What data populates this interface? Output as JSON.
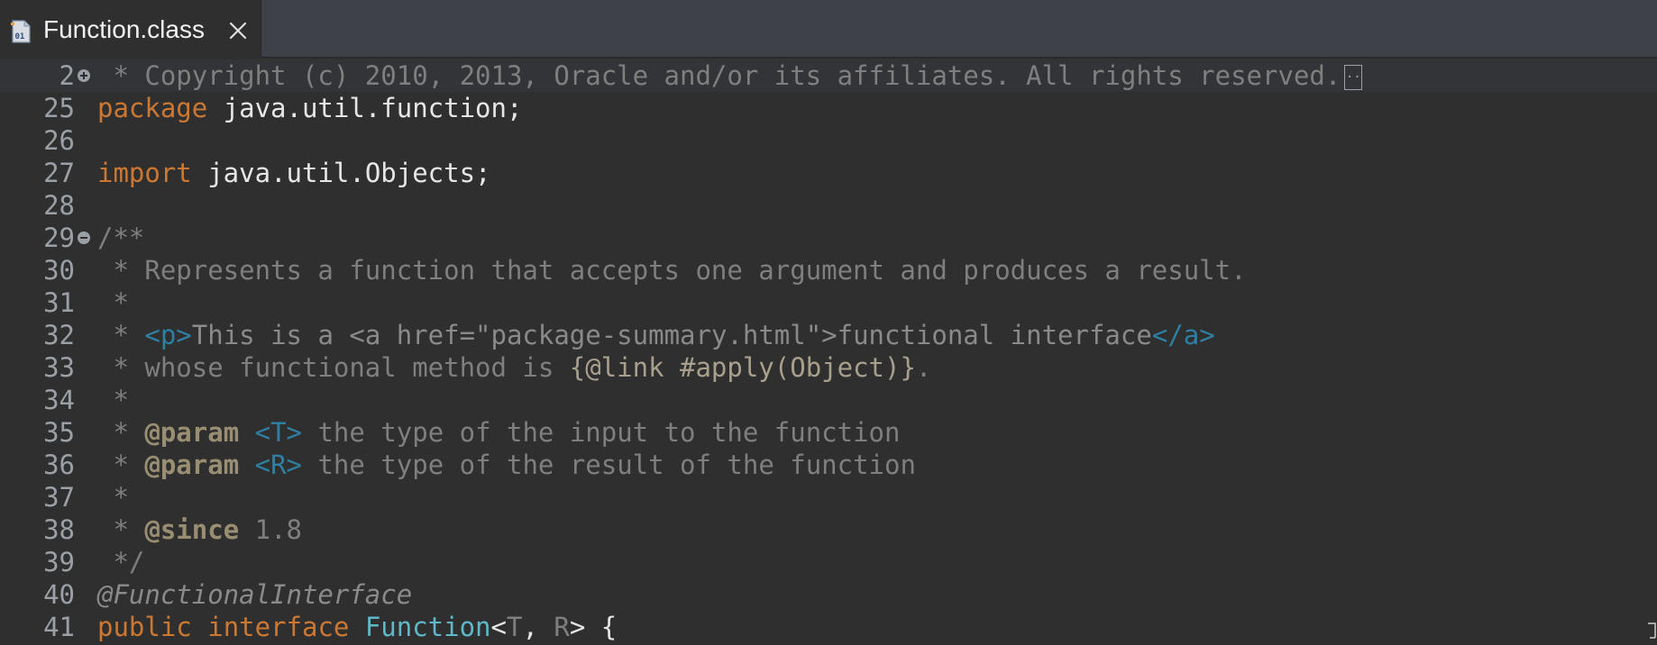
{
  "tab": {
    "title": "Function.class",
    "icon": "class-file-icon",
    "close_icon": "close-icon"
  },
  "editor": {
    "lines": [
      {
        "num": "2",
        "fold": "expand",
        "current": true,
        "parts": [
          {
            "cls": "cm",
            "text": " * Copyright (c) 2010, 2013, Oracle and/or its affiliates. All rights reserved."
          }
        ],
        "folded_marker": ".."
      },
      {
        "num": "25",
        "parts": [
          {
            "cls": "kw",
            "text": "package"
          },
          {
            "cls": "txt",
            "text": " java.util.function;"
          }
        ]
      },
      {
        "num": "26",
        "parts": []
      },
      {
        "num": "27",
        "parts": [
          {
            "cls": "kw",
            "text": "import"
          },
          {
            "cls": "txt",
            "text": " java.util.Objects;"
          }
        ]
      },
      {
        "num": "28",
        "parts": []
      },
      {
        "num": "29",
        "fold": "collapse",
        "parts": [
          {
            "cls": "cm",
            "text": "/**"
          }
        ]
      },
      {
        "num": "30",
        "parts": [
          {
            "cls": "cm",
            "text": " * Represents a function that accepts one argument and produces a result."
          }
        ]
      },
      {
        "num": "31",
        "parts": [
          {
            "cls": "cm",
            "text": " *"
          }
        ]
      },
      {
        "num": "32",
        "parts": [
          {
            "cls": "cm",
            "text": " * "
          },
          {
            "cls": "tag",
            "text": "<p>"
          },
          {
            "cls": "tagtxt",
            "text": "This is a <a href=\"package-summary.html\">functional interface"
          },
          {
            "cls": "tag",
            "text": "</a>"
          }
        ]
      },
      {
        "num": "33",
        "parts": [
          {
            "cls": "cm",
            "text": " * whose functional method is "
          },
          {
            "cls": "lnk",
            "text": "{@link #apply(Object)}"
          },
          {
            "cls": "cm",
            "text": "."
          }
        ]
      },
      {
        "num": "34",
        "parts": [
          {
            "cls": "cm",
            "text": " *"
          }
        ]
      },
      {
        "num": "35",
        "parts": [
          {
            "cls": "cm",
            "text": " * "
          },
          {
            "cls": "doctag",
            "text": "@param"
          },
          {
            "cls": "cm",
            "text": " "
          },
          {
            "cls": "tparam",
            "text": "<T>"
          },
          {
            "cls": "cm",
            "text": " the type of the input to the function"
          }
        ]
      },
      {
        "num": "36",
        "parts": [
          {
            "cls": "cm",
            "text": " * "
          },
          {
            "cls": "doctag",
            "text": "@param"
          },
          {
            "cls": "cm",
            "text": " "
          },
          {
            "cls": "tparam",
            "text": "<R>"
          },
          {
            "cls": "cm",
            "text": " the type of the result of the function"
          }
        ]
      },
      {
        "num": "37",
        "parts": [
          {
            "cls": "cm",
            "text": " *"
          }
        ]
      },
      {
        "num": "38",
        "parts": [
          {
            "cls": "cm",
            "text": " * "
          },
          {
            "cls": "doctag",
            "text": "@since"
          },
          {
            "cls": "cm",
            "text": " 1.8"
          }
        ]
      },
      {
        "num": "39",
        "parts": [
          {
            "cls": "cm",
            "text": " */"
          }
        ]
      },
      {
        "num": "40",
        "parts": [
          {
            "cls": "anno",
            "text": "@FunctionalInterface"
          }
        ]
      },
      {
        "num": "41",
        "parts": [
          {
            "cls": "kw",
            "text": "public"
          },
          {
            "cls": "txt",
            "text": " "
          },
          {
            "cls": "kw",
            "text": "interface"
          },
          {
            "cls": "txt",
            "text": " "
          },
          {
            "cls": "type",
            "text": "Function"
          },
          {
            "cls": "txt",
            "text": "<"
          },
          {
            "cls": "cm",
            "text": "T"
          },
          {
            "cls": "txt",
            "text": ", "
          },
          {
            "cls": "cm",
            "text": "R"
          },
          {
            "cls": "txt",
            "text": "> {"
          }
        ]
      }
    ]
  }
}
